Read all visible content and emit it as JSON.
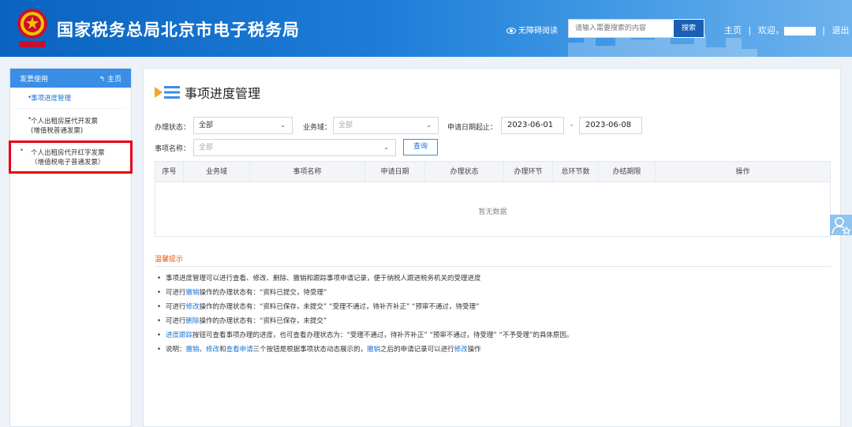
{
  "header": {
    "title": "国家税务总局北京市电子税务局",
    "accessibility": "无障碍阅读",
    "search_placeholder": "请输入需要搜索的内容",
    "search_button": "搜索",
    "nav_home": "主页",
    "nav_welcome": "欢迎，",
    "nav_logout": "退出",
    "separator": "|"
  },
  "sidebar": {
    "heading": "发票使用",
    "home_link": "主页",
    "items": [
      {
        "line1": "事项进度管理",
        "line2": ""
      },
      {
        "line1": "个人出租房屋代开发票",
        "line2": "(增值税普通发票)"
      },
      {
        "line1": "个人出租房代开红字发票",
        "line2": "（增值税电子普通发票）"
      }
    ]
  },
  "main": {
    "title": "事项进度管理",
    "filters": {
      "status_label": "办理状态：",
      "status_value": "全部",
      "domain_label": "业务域：",
      "domain_value": "全部",
      "date_label": "申请日期起止：",
      "date_from": "2023-06-01",
      "date_sep": "-",
      "date_to": "2023-06-08",
      "name_label": "事项名称：",
      "name_value": "全部",
      "query_button": "查询"
    },
    "table": {
      "columns": [
        "序号",
        "业务域",
        "事项名称",
        "申请日期",
        "办理状态",
        "办理环节",
        "总环节数",
        "办结期限",
        "操作"
      ],
      "empty_text": "暂无数据"
    },
    "tips": {
      "title": "温馨提示",
      "lines": [
        {
          "a": "事项进度管理可以进行查看、修改、删除、撤销和跟踪事项申请记录，便于纳税人跟进税务机关的受理进度"
        },
        {
          "a": "可进行",
          "b": "撤销",
          "c": "操作的办理状态有：“资料已提交，待受理”"
        },
        {
          "a": "可进行",
          "b": "修改",
          "c": "操作的办理状态有：“资料已保存，未提交”  “受理不通过，待补齐补正”  “预审不通过，待受理”"
        },
        {
          "a": "可进行",
          "b": "删除",
          "c": "操作的办理状态有：“资料已保存，未提交”"
        },
        {
          "b": "进度跟踪",
          "c": "按钮可查看事项办理的进度，也可查看办理状态为：“受理不通过，待补齐补正”  “预审不通过，待受理”  “不予受理”的具体原因。"
        },
        {
          "a": "说明：",
          "b": "撤销",
          "c": "、",
          "d": "修改",
          "e": "和",
          "f": "查看申请",
          "g": "三个按钮是根据事项状态动态展示的，",
          "h": "撤销",
          "i": "之后的申请记录可以进行",
          "j": "修改",
          "k": "操作"
        }
      ]
    }
  },
  "colors": {
    "brand_blue": "#1a73d9",
    "header_blue": "#0a63bf",
    "highlight_red": "#e60012",
    "tip_orange": "#e8590c"
  }
}
